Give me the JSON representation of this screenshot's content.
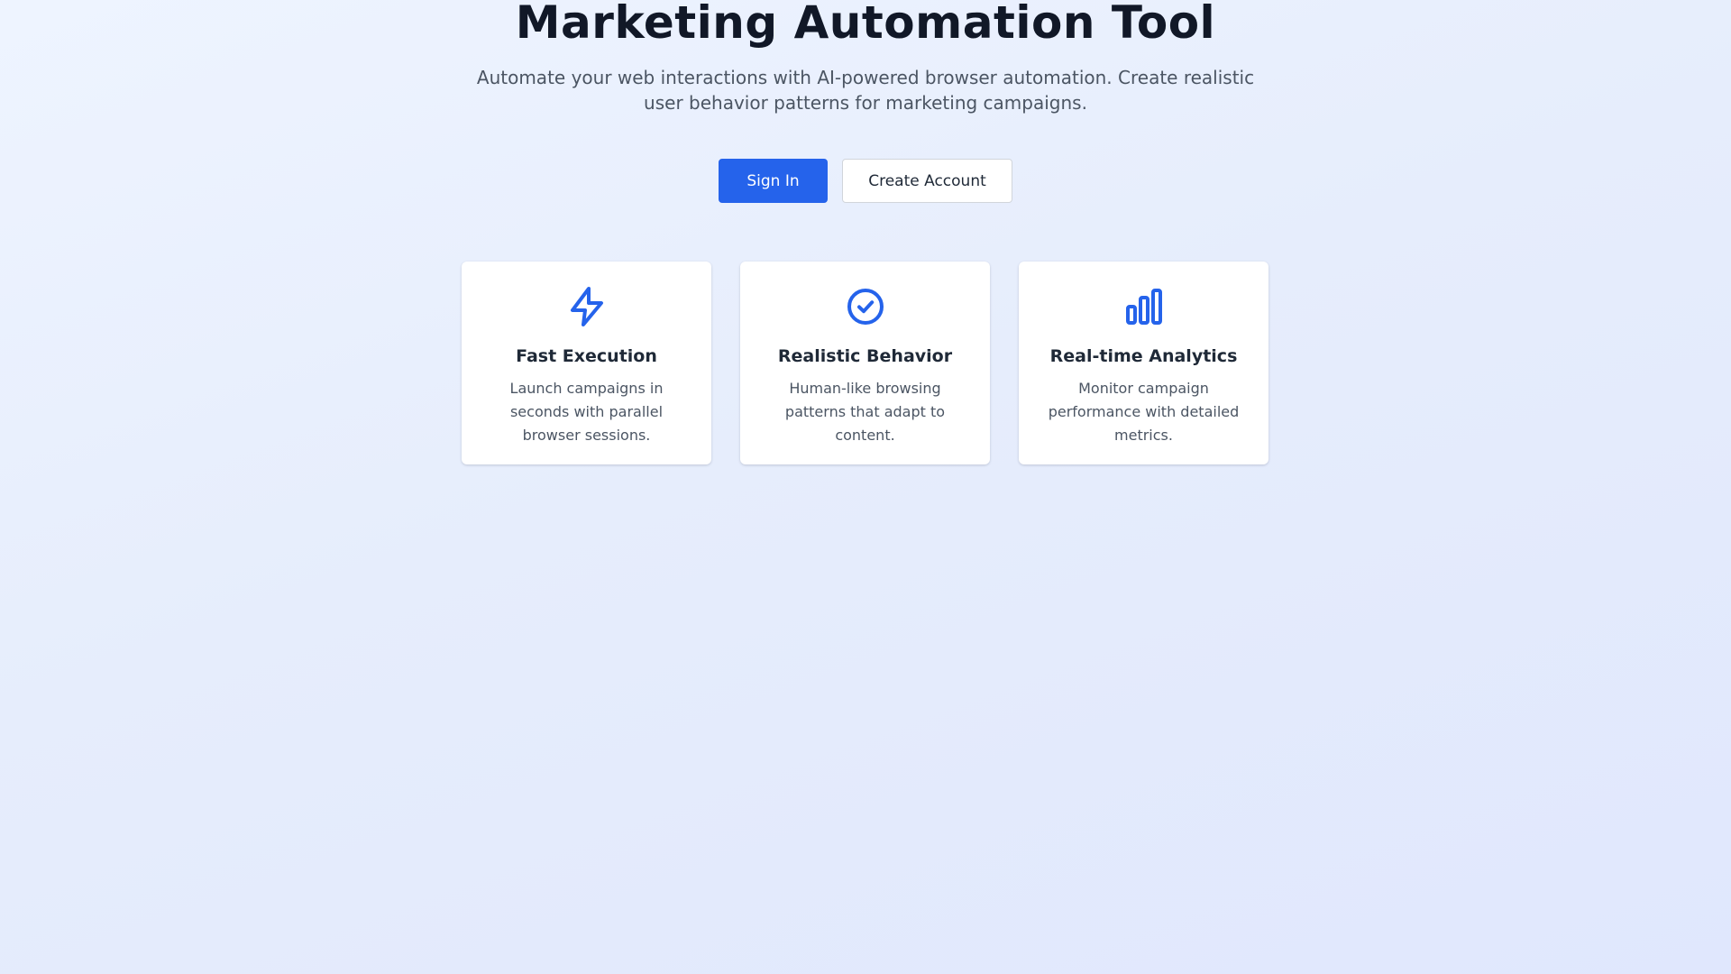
{
  "hero": {
    "title": "Marketing Automation Tool",
    "subtitle": "Automate your web interactions with AI-powered browser automation. Create realistic user behavior patterns for marketing campaigns."
  },
  "actions": {
    "sign_in_label": "Sign In",
    "create_account_label": "Create Account"
  },
  "features": [
    {
      "icon": "lightning-icon",
      "title": "Fast Execution",
      "description": "Launch campaigns in seconds with parallel browser sessions."
    },
    {
      "icon": "check-circle-icon",
      "title": "Realistic Behavior",
      "description": "Human-like browsing patterns that adapt to content."
    },
    {
      "icon": "bar-chart-icon",
      "title": "Real-time Analytics",
      "description": "Monitor campaign performance with detailed metrics."
    }
  ],
  "colors": {
    "accent": "#2563eb",
    "title": "#111827",
    "text_muted": "#4b5563",
    "card_background": "#ffffff"
  }
}
